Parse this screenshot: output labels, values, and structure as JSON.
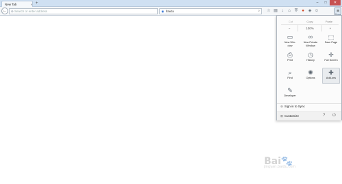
{
  "tabs": [
    {
      "label": "New Tab"
    }
  ],
  "window_controls": {
    "minimize": "–",
    "maximize": "□",
    "close": "✕"
  },
  "nav": {
    "url_placeholder": "Search or enter address",
    "search_value": "baidu",
    "search_engine_icon": "search-engine-logo"
  },
  "menu": {
    "edit": {
      "cut": "Cut",
      "copy": "Copy",
      "paste": "Paste"
    },
    "zoom": {
      "minus": "−",
      "value": "100%",
      "plus": "+"
    },
    "items": [
      {
        "label": "New Win-\ndow",
        "icon": "new-window-icon",
        "glyph": "▭"
      },
      {
        "label": "New Private\nWindow",
        "icon": "private-window-icon",
        "glyph": "∞"
      },
      {
        "label": "Save Page",
        "icon": "save-page-icon",
        "glyph": "⬚"
      },
      {
        "label": "Print",
        "icon": "print-icon",
        "glyph": "⎙"
      },
      {
        "label": "History",
        "icon": "history-icon",
        "glyph": "◷"
      },
      {
        "label": "Full Screen",
        "icon": "full-screen-icon",
        "glyph": "✛"
      },
      {
        "label": "Find",
        "icon": "find-icon",
        "glyph": "⌕"
      },
      {
        "label": "Options",
        "icon": "options-icon",
        "glyph": "✺"
      },
      {
        "label": "Add-ons",
        "icon": "addons-icon",
        "glyph": "✚"
      },
      {
        "label": "Developer",
        "icon": "developer-icon",
        "glyph": "✎"
      }
    ],
    "sign_in": "Sign in to Sync",
    "customize": "Customize"
  },
  "watermark": {
    "text": "Bai",
    "sub": "jingyan.baidu.com"
  }
}
